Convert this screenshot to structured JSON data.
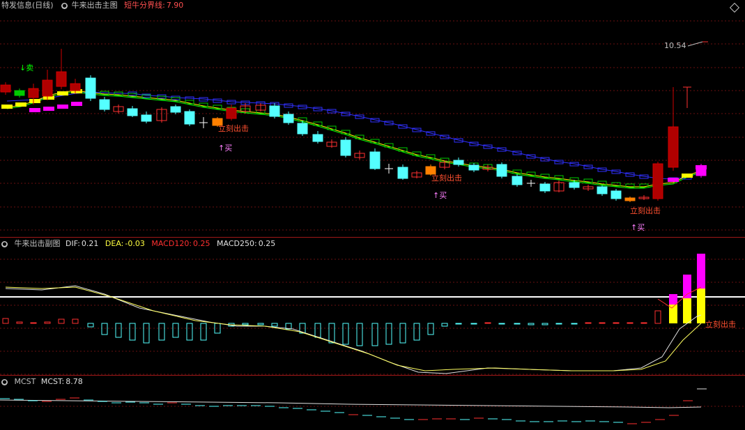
{
  "main": {
    "stock_name": "特发信息(日线)",
    "indicator": "牛来出击主图",
    "line_label": "短牛分界线:",
    "line_value": "7.90",
    "price_label": "10.54",
    "sell_label": "↓卖",
    "buy_label": "↑买",
    "exit_label": "立刻出击",
    "mixed_label": "立刻出击",
    "colors": {
      "up": "#ff3030",
      "down": "#54ffff",
      "green": "#00ff00",
      "blue": "#2020ff",
      "yellow": "#ffff00",
      "magenta": "#ff00ff",
      "orange": "#ff8000"
    }
  },
  "sub": {
    "indicator": "牛来出击副图",
    "dif_label": "DIF:",
    "dif_value": "0.21",
    "dea_label": "DEA:",
    "dea_value": "-0.03",
    "macd120_label": "MACD120:",
    "macd120_value": "0.25",
    "macd250_label": "MACD250:",
    "macd250_value": "0.25",
    "end_label": "立刻出击"
  },
  "mcst": {
    "indicator": "MCST",
    "mcst_label": "MCST:",
    "mcst_value": "8.78"
  }
}
